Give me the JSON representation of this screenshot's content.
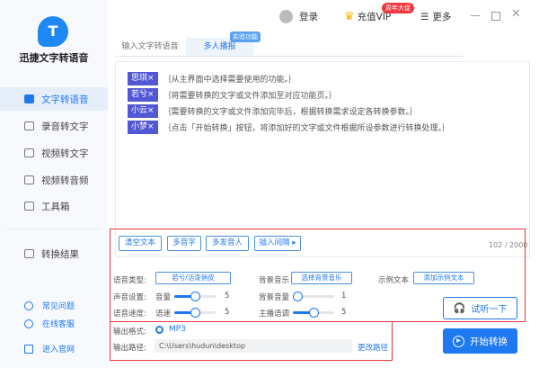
{
  "app": {
    "name": "迅捷文字转语音",
    "logo_letter": "T"
  },
  "sidebar": {
    "items": [
      {
        "label": "文字转语音",
        "active": true
      },
      {
        "label": "录音转文字"
      },
      {
        "label": "视频转文字"
      },
      {
        "label": "视频转音频"
      },
      {
        "label": "工具箱"
      }
    ],
    "results": "转换结果",
    "footer": [
      "常见问题",
      "在线客服",
      "进入官网"
    ]
  },
  "topbar": {
    "login": "登录",
    "vip": "充值VIP",
    "vip_badge": "周年大促",
    "more": "更多"
  },
  "tabs": [
    {
      "label": "输入文字转语音"
    },
    {
      "label": "多人播报",
      "active": true,
      "badge": "实验功能"
    }
  ],
  "lines": [
    {
      "speaker": "思琪×",
      "text": "｛从主界面中选择需要使用的功能。｝"
    },
    {
      "speaker": "若兮×",
      "text": "｛将需要转换的文字或文件添加至对应功能页。｝"
    },
    {
      "speaker": "小云×",
      "text": "｛需要转换的文字或文件添加完毕后，根据转换需求设定各转换参数。｝"
    },
    {
      "speaker": "小梦×",
      "text": "｛点击「开始转换」按钮，将添加好的文字或文件根据所设参数进行转换处理。｝"
    }
  ],
  "editor_buttons": [
    "清空文本",
    "多音字",
    "多发音人",
    "插入间隔 ▸"
  ],
  "char_count": "102 / 2000",
  "settings": {
    "voice_type_label": "语音类型:",
    "voice_type_value": "若兮/活泼俏皮",
    "bgm_label": "背景音乐",
    "bgm_button": "选择背景音乐",
    "sample_label": "示例文本",
    "sample_button": "添加示例文本",
    "sound_label": "声音设置:",
    "volume_label": "音量",
    "volume": 5,
    "bg_volume_label": "背景音量",
    "bg_volume": 1,
    "speed_group_label": "语音速度:",
    "speed_label": "语速",
    "speed": 5,
    "pitch_label": "主播语调",
    "pitch": 5,
    "slider_max": 10
  },
  "listen_button": "试听一下",
  "output": {
    "format_label": "输出格式:",
    "format": "MP3",
    "path_label": "输出路径:",
    "path": "C:\\Users\\hudun\\desktop",
    "change_path": "更改路径"
  },
  "start_button": "开始转换",
  "colors": {
    "accent": "#1e78f0",
    "tag": "#5257d6",
    "highlight": "#e8333c"
  }
}
